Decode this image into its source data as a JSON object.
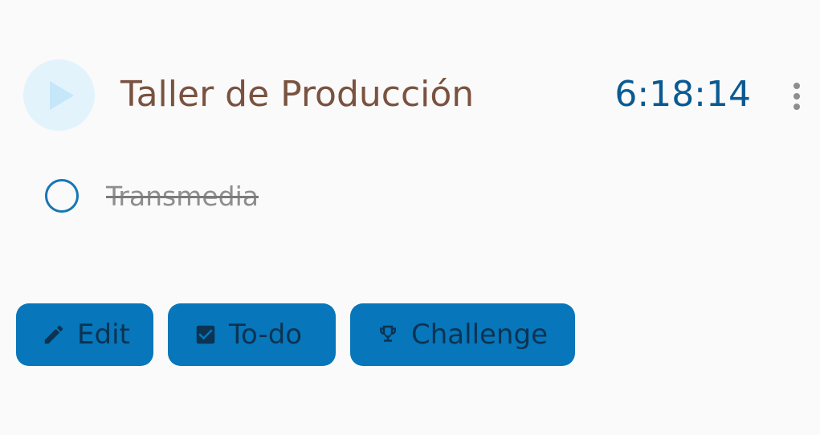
{
  "project": {
    "title": "Taller de Producción",
    "timer": "6:18:14"
  },
  "task": {
    "label": "Transmedia",
    "completed": true
  },
  "actions": {
    "edit_label": "Edit",
    "todo_label": "To-do",
    "challenge_label": "Challenge"
  },
  "icons": {
    "play": "play-icon",
    "menu": "more-vertical-icon",
    "task_check": "circle-checkbox-icon",
    "edit": "pencil-icon",
    "todo": "checkbox-checked-icon",
    "challenge": "trophy-icon"
  },
  "colors": {
    "background": "#fafafa",
    "play_circle": "#e3f3fc",
    "play_arrow": "#c6e6f9",
    "title": "#7a5240",
    "timer": "#0a5a92",
    "menu_dots": "#8e8e8e",
    "task_check": "#1876b3",
    "task_text": "#8e8e8e",
    "button_bg": "#0776ba",
    "button_text": "#0c3352"
  }
}
